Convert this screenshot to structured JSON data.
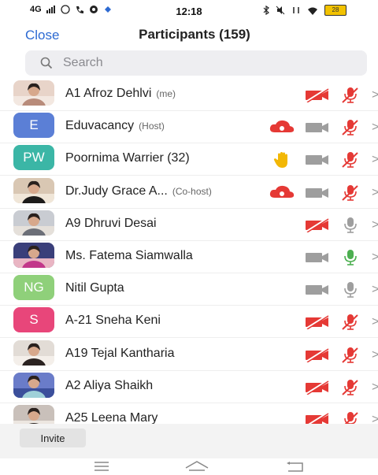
{
  "status_bar": {
    "network": "4G",
    "time": "12:18",
    "battery": "28"
  },
  "header": {
    "close_label": "Close",
    "title": "Participants (159)"
  },
  "search": {
    "placeholder": "Search"
  },
  "participants": [
    {
      "name": "A1 Afroz Dehlvi",
      "role": "(me)",
      "avatar_type": "photo",
      "video": "off",
      "mic": "muted",
      "extra": ""
    },
    {
      "name": "Eduvacancy",
      "role": "(Host)",
      "avatar_type": "letter",
      "initials": "E",
      "avatar_color": "#5b7fd6",
      "video": "on",
      "mic": "muted",
      "extra": "cloud-record"
    },
    {
      "name": "Poornima Warrier (32)",
      "role": "",
      "avatar_type": "letter",
      "initials": "PW",
      "avatar_color": "#3bb6a6",
      "video": "on",
      "mic": "muted",
      "extra": "raised-hand"
    },
    {
      "name": "Dr.Judy Grace A...",
      "role": "(Co-host)",
      "avatar_type": "photo",
      "video": "on",
      "mic": "muted",
      "extra": "cloud-record"
    },
    {
      "name": "A9 Dhruvi Desai",
      "role": "",
      "avatar_type": "photo",
      "video": "off",
      "mic": "idle",
      "extra": ""
    },
    {
      "name": "Ms. Fatema Siamwalla",
      "role": "",
      "avatar_type": "photo",
      "video": "on",
      "mic": "active",
      "extra": ""
    },
    {
      "name": "Nitil Gupta",
      "role": "",
      "avatar_type": "letter",
      "initials": "NG",
      "avatar_color": "#8fd07a",
      "video": "on",
      "mic": "idle",
      "extra": ""
    },
    {
      "name": "A-21 Sneha Keni",
      "role": "",
      "avatar_type": "letter",
      "initials": "S",
      "avatar_color": "#e8467a",
      "video": "off",
      "mic": "muted",
      "extra": ""
    },
    {
      "name": "A19 Tejal Kantharia",
      "role": "",
      "avatar_type": "photo",
      "video": "off",
      "mic": "muted",
      "extra": ""
    },
    {
      "name": "A2 Aliya Shaikh",
      "role": "",
      "avatar_type": "photo",
      "video": "off",
      "mic": "muted",
      "extra": ""
    },
    {
      "name": "A25 Leena Mary",
      "role": "",
      "avatar_type": "photo",
      "video": "off",
      "mic": "muted",
      "extra": ""
    }
  ],
  "footer": {
    "invite_label": "Invite"
  },
  "colors": {
    "accent": "#2d6ad2",
    "muted_red": "#e53935",
    "icon_gray": "#9e9e9e",
    "mic_active": "#4caf50",
    "hand_yellow": "#f2b705"
  }
}
